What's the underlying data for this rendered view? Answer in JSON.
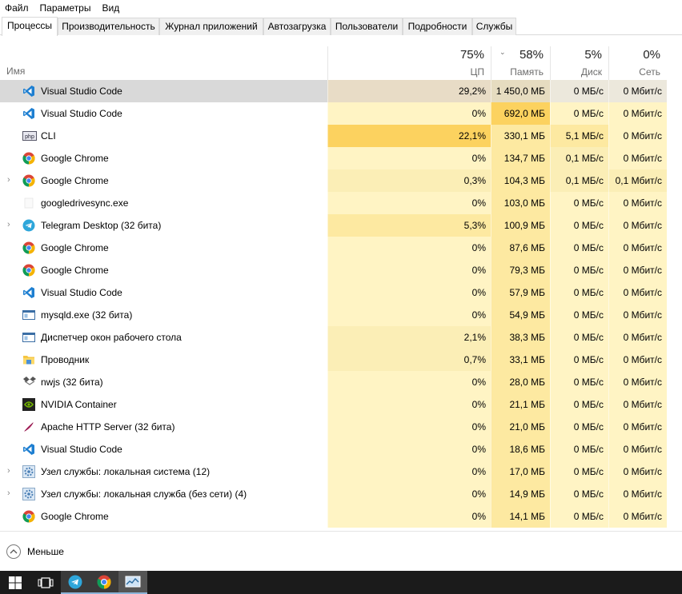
{
  "menu": [
    "Файл",
    "Параметры",
    "Вид"
  ],
  "tabs": [
    {
      "label": "Процессы",
      "active": true
    },
    {
      "label": "Производительность"
    },
    {
      "label": "Журнал приложений"
    },
    {
      "label": "Автозагрузка"
    },
    {
      "label": "Пользователи"
    },
    {
      "label": "Подробности"
    },
    {
      "label": "Службы"
    }
  ],
  "header": {
    "name_label": "Имя",
    "cpu": {
      "pct": "75%",
      "label": "ЦП"
    },
    "mem": {
      "pct": "58%",
      "label": "Память"
    },
    "disk": {
      "pct": "5%",
      "label": "Диск"
    },
    "net": {
      "pct": "0%",
      "label": "Сеть"
    }
  },
  "processes": [
    {
      "name": "Visual Studio Code",
      "icon": "vscode-icon",
      "expandable": false,
      "cpu": "29,2%",
      "mem": "1 450,0 МБ",
      "disk": "0 МБ/с",
      "net": "0 Мбит/с",
      "selected": true
    },
    {
      "name": "Visual Studio Code",
      "icon": "vscode-icon",
      "expandable": false,
      "cpu": "0%",
      "mem": "692,0 МБ",
      "disk": "0 МБ/с",
      "net": "0 Мбит/с"
    },
    {
      "name": "CLI",
      "icon": "php-icon",
      "expandable": false,
      "cpu": "22,1%",
      "mem": "330,1 МБ",
      "disk": "5,1 МБ/с",
      "net": "0 Мбит/с"
    },
    {
      "name": "Google Chrome",
      "icon": "chrome-icon",
      "expandable": false,
      "cpu": "0%",
      "mem": "134,7 МБ",
      "disk": "0,1 МБ/с",
      "net": "0 Мбит/с"
    },
    {
      "name": "Google Chrome",
      "icon": "chrome-icon",
      "expandable": true,
      "cpu": "0,3%",
      "mem": "104,3 МБ",
      "disk": "0,1 МБ/с",
      "net": "0,1 Мбит/с"
    },
    {
      "name": "googledrivesync.exe",
      "icon": "blank-icon",
      "expandable": false,
      "cpu": "0%",
      "mem": "103,0 МБ",
      "disk": "0 МБ/с",
      "net": "0 Мбит/с"
    },
    {
      "name": "Telegram Desktop (32 бита)",
      "icon": "telegram-icon",
      "expandable": true,
      "cpu": "5,3%",
      "mem": "100,9 МБ",
      "disk": "0 МБ/с",
      "net": "0 Мбит/с"
    },
    {
      "name": "Google Chrome",
      "icon": "chrome-icon",
      "expandable": false,
      "cpu": "0%",
      "mem": "87,6 МБ",
      "disk": "0 МБ/с",
      "net": "0 Мбит/с"
    },
    {
      "name": "Google Chrome",
      "icon": "chrome-icon",
      "expandable": false,
      "cpu": "0%",
      "mem": "79,3 МБ",
      "disk": "0 МБ/с",
      "net": "0 Мбит/с"
    },
    {
      "name": "Visual Studio Code",
      "icon": "vscode-icon",
      "expandable": false,
      "cpu": "0%",
      "mem": "57,9 МБ",
      "disk": "0 МБ/с",
      "net": "0 Мбит/с"
    },
    {
      "name": "mysqld.exe (32 бита)",
      "icon": "window-icon",
      "expandable": false,
      "cpu": "0%",
      "mem": "54,9 МБ",
      "disk": "0 МБ/с",
      "net": "0 Мбит/с"
    },
    {
      "name": "Диспетчер окон рабочего стола",
      "icon": "window-icon",
      "expandable": false,
      "cpu": "2,1%",
      "mem": "38,3 МБ",
      "disk": "0 МБ/с",
      "net": "0 Мбит/с"
    },
    {
      "name": "Проводник",
      "icon": "folder-icon",
      "expandable": false,
      "cpu": "0,7%",
      "mem": "33,1 МБ",
      "disk": "0 МБ/с",
      "net": "0 Мбит/с"
    },
    {
      "name": "nwjs (32 бита)",
      "icon": "nwjs-icon",
      "expandable": false,
      "cpu": "0%",
      "mem": "28,0 МБ",
      "disk": "0 МБ/с",
      "net": "0 Мбит/с"
    },
    {
      "name": "NVIDIA Container",
      "icon": "nvidia-icon",
      "expandable": false,
      "cpu": "0%",
      "mem": "21,1 МБ",
      "disk": "0 МБ/с",
      "net": "0 Мбит/с"
    },
    {
      "name": "Apache HTTP Server (32 бита)",
      "icon": "apache-feather-icon",
      "expandable": false,
      "cpu": "0%",
      "mem": "21,0 МБ",
      "disk": "0 МБ/с",
      "net": "0 Мбит/с"
    },
    {
      "name": "Visual Studio Code",
      "icon": "vscode-icon",
      "expandable": false,
      "cpu": "0%",
      "mem": "18,6 МБ",
      "disk": "0 МБ/с",
      "net": "0 Мбит/с"
    },
    {
      "name": "Узел службы: локальная система (12)",
      "icon": "gear-icon",
      "expandable": true,
      "cpu": "0%",
      "mem": "17,0 МБ",
      "disk": "0 МБ/с",
      "net": "0 Мбит/с"
    },
    {
      "name": "Узел службы: локальная служба (без сети) (4)",
      "icon": "gear-icon",
      "expandable": true,
      "cpu": "0%",
      "mem": "14,9 МБ",
      "disk": "0 МБ/с",
      "net": "0 Мбит/с"
    },
    {
      "name": "Google Chrome",
      "icon": "chrome-icon",
      "expandable": false,
      "cpu": "0%",
      "mem": "14,1 МБ",
      "disk": "0 МБ/с",
      "net": "0 Мбит/с"
    }
  ],
  "footer": {
    "less_label": "Меньше"
  },
  "taskbar": [
    "windows-start-icon",
    "task-view-icon",
    "telegram-icon",
    "chrome-icon",
    "task-manager-icon"
  ],
  "colors": {
    "heat_low": "#fff4c4",
    "heat_mid": "#fbe9a6",
    "heat_high": "#fcd25f",
    "selected_row": "#d9d9d9"
  }
}
